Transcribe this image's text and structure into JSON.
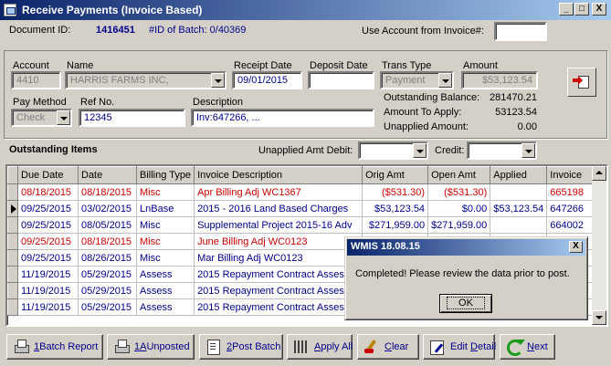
{
  "window": {
    "title": "Receive Payments (Invoice Based)",
    "btn_min": "_",
    "btn_max": "□",
    "btn_close": "X"
  },
  "header": {
    "doc_id_label": "Document ID:",
    "doc_id_value": "1416451",
    "batch_label": "#ID of Batch: 0/40369",
    "use_account_label": "Use Account from Invoice#:",
    "use_account_value": ""
  },
  "form": {
    "account_label": "Account",
    "account_value": "4410",
    "name_label": "Name",
    "name_value": "HARRIS FARMS INC,",
    "receipt_date_label": "Receipt Date",
    "receipt_date_value": "09/01/2015",
    "deposit_date_label": "Deposit Date",
    "deposit_date_value": "",
    "trans_type_label": "Trans Type",
    "trans_type_value": "Payment",
    "amount_label": "Amount",
    "amount_value": "$53,123.54",
    "pay_method_label": "Pay Method",
    "pay_method_value": "Check",
    "ref_no_label": "Ref No.",
    "ref_no_value": "12345",
    "description_label": "Description",
    "description_value": "Inv:647266,  ...",
    "outstanding_balance_label": "Outstanding Balance:",
    "outstanding_balance_value": "281470.21",
    "amount_to_apply_label": "Amount To Apply:",
    "amount_to_apply_value": "53123.54",
    "unapplied_label": "Unapplied Amount:",
    "unapplied_value": "0.00"
  },
  "outstanding": {
    "title": "Outstanding Items",
    "unapplied_debit_label": "Unapplied Amt Debit:",
    "credit_label": "Credit:"
  },
  "table": {
    "columns": [
      "Due Date",
      "Date",
      "Billing Type",
      "Invoice Description",
      "Orig Amt",
      "Open Amt",
      "Applied",
      "Invoice"
    ],
    "rows": [
      {
        "due": "08/18/2015",
        "date": "08/18/2015",
        "type": "Misc",
        "desc": "Apr Billing Adj WC1367",
        "orig": "($531.30)",
        "open": "($531.30)",
        "applied": "",
        "invoice": "665198",
        "color": "red"
      },
      {
        "due": "09/25/2015",
        "date": "03/02/2015",
        "type": "LnBase",
        "desc": "2015 - 2016 Land Based Charges",
        "orig": "$53,123.54",
        "open": "$0.00",
        "applied": "$53,123.54",
        "invoice": "647266",
        "color": "blue"
      },
      {
        "due": "09/25/2015",
        "date": "08/05/2015",
        "type": "Misc",
        "desc": "Supplemental Project 2015-16 Adv",
        "orig": "$271,959.00",
        "open": "$271,959.00",
        "applied": "",
        "invoice": "664002",
        "color": "blue"
      },
      {
        "due": "09/25/2015",
        "date": "08/18/2015",
        "type": "Misc",
        "desc": "June Billing Adj WC0123",
        "orig": "",
        "open": "",
        "applied": "",
        "invoice": "",
        "color": "red"
      },
      {
        "due": "09/25/2015",
        "date": "08/26/2015",
        "type": "Misc",
        "desc": "Mar Billing Adj WC0123",
        "orig": "",
        "open": "",
        "applied": "",
        "invoice": "",
        "color": "blue"
      },
      {
        "due": "11/19/2015",
        "date": "05/29/2015",
        "type": "Assess",
        "desc": "2015 Repayment Contract Assessi",
        "orig": "",
        "open": "",
        "applied": "",
        "invoice": "",
        "color": "blue"
      },
      {
        "due": "11/19/2015",
        "date": "05/29/2015",
        "type": "Assess",
        "desc": "2015 Repayment Contract Assessi",
        "orig": "",
        "open": "",
        "applied": "",
        "invoice": "",
        "color": "blue"
      },
      {
        "due": "11/19/2015",
        "date": "05/29/2015",
        "type": "Assess",
        "desc": "2015 Repayment Contract Assessi",
        "orig": "",
        "open": "",
        "applied": "",
        "invoice": "",
        "color": "blue"
      }
    ]
  },
  "toolbar": {
    "batch_report_num": "1",
    "batch_report_label": " Batch Report",
    "unposted_num": "1A",
    "unposted_label": " Unposted",
    "post_batch_num": "2",
    "post_batch_label": " Post Batch",
    "apply_all_u": "A",
    "apply_all_label": "pply All",
    "clear_u": "C",
    "clear_label": "lear",
    "edit_detail_pre": "Edit ",
    "edit_detail_u": "D",
    "edit_detail_label": "etail",
    "next_u": "N",
    "next_label": "ext"
  },
  "dialog": {
    "title": "WMIS 18.08.15",
    "close": "X",
    "message": "Completed! Please review the data prior to post.",
    "ok_label": "OK"
  }
}
